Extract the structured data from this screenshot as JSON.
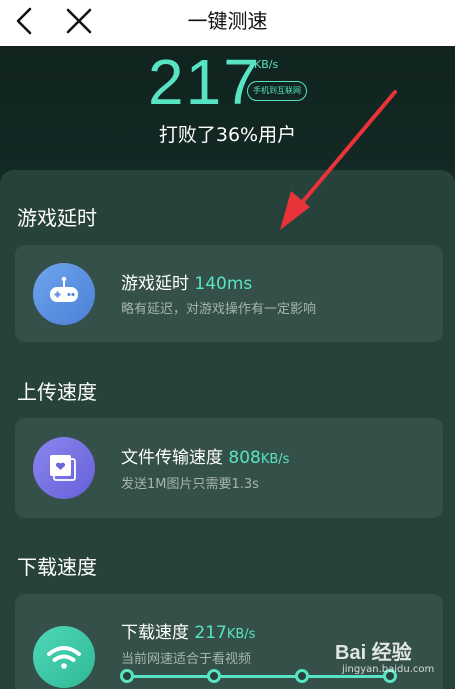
{
  "header": {
    "title": "一键测速"
  },
  "result": {
    "speed": "217",
    "unit": "KB/s",
    "network_badge": "手机到互联网",
    "beat_text": "打败了36%用户"
  },
  "sections": {
    "game": {
      "title": "游戏延时",
      "card_title": "游戏延时",
      "value": "140ms",
      "subtitle": "略有延迟，对游戏操作有一定影响"
    },
    "upload": {
      "title": "上传速度",
      "card_title": "文件传输速度",
      "value": "808",
      "unit": "KB/s",
      "subtitle": "发送1M图片只需要1.3s"
    },
    "download": {
      "title": "下载速度",
      "card_title": "下载速度",
      "value": "217",
      "unit": "KB/s",
      "subtitle": "当前网速适合于看视频"
    }
  },
  "watermark": {
    "text": "Bai 经验",
    "sub": "jingyan.baidu.com"
  },
  "colors": {
    "accent": "#58e4c4",
    "arrow": "#e8333a",
    "background": "#17302a",
    "card": "#345048"
  },
  "icons": [
    "back-icon",
    "close-icon",
    "gamepad-icon",
    "file-transfer-icon",
    "wifi-icon"
  ]
}
